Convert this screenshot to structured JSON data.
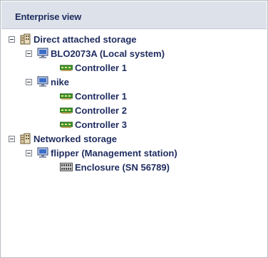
{
  "header": {
    "title": "Enterprise view"
  },
  "tree": {
    "direct": {
      "label": "Direct attached storage"
    },
    "blo": {
      "label": "BLO2073A (Local system)"
    },
    "blo_c1": {
      "label": "Controller 1"
    },
    "nike": {
      "label": "nike"
    },
    "nike_c1": {
      "label": "Controller 1"
    },
    "nike_c2": {
      "label": "Controller 2"
    },
    "nike_c3": {
      "label": "Controller 3"
    },
    "networked": {
      "label": "Networked storage"
    },
    "flipper": {
      "label": "flipper (Management station)"
    },
    "enclosure": {
      "label": "Enclosure (SN 56789)"
    }
  },
  "icons": {
    "storage": "storage-building-icon",
    "system": "computer-monitor-icon",
    "controller": "controller-card-icon",
    "enclosure": "enclosure-icon"
  },
  "colors": {
    "text": "#1e2c5f",
    "header_bg": "#dde2ea",
    "controller_green": "#3f9a2e",
    "monitor_blue": "#3a6fc9"
  }
}
